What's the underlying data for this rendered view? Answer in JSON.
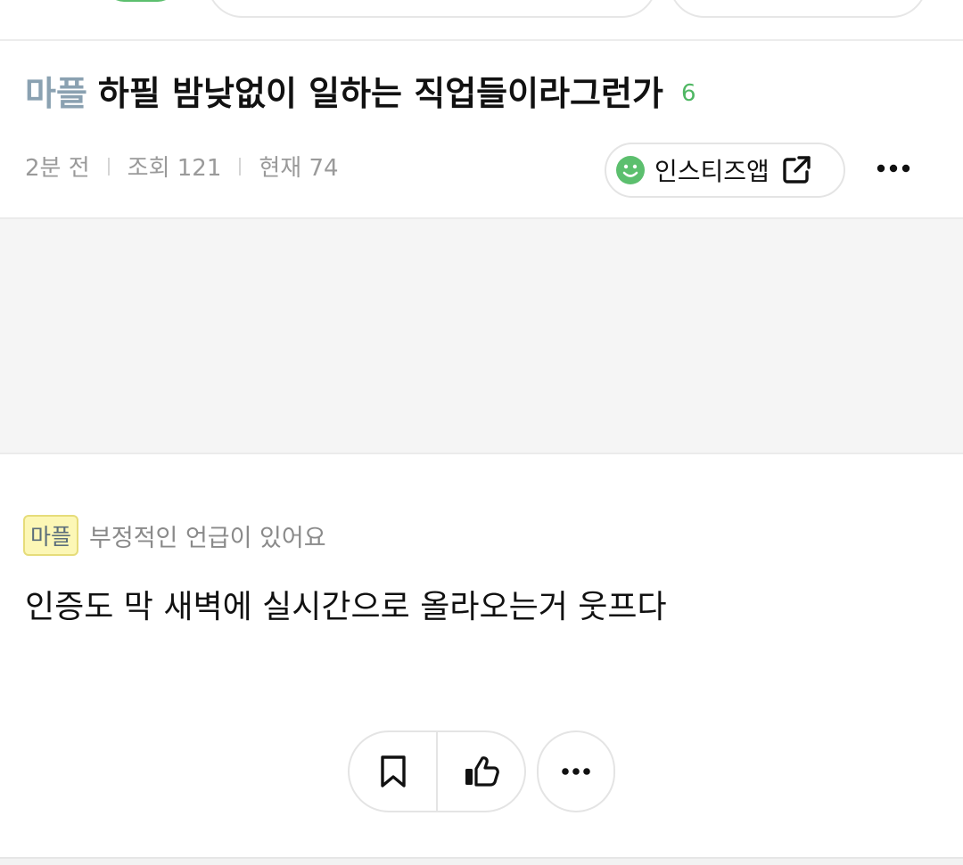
{
  "post": {
    "category": "마플",
    "title": "하필 밤낮없이 일하는 직업들이라그런가",
    "comment_count": "6",
    "time_ago": "2분 전",
    "views": "조회 121",
    "current": "현재 74",
    "app_button_label": "인스티즈앱"
  },
  "comment": {
    "tag": "마플",
    "label": "부정적인 언급이 있어요",
    "body": "인증도 막 새벽에 실시간으로 올라오는거 웃프다"
  },
  "colors": {
    "category": "#8aa1b1",
    "comment_count": "#4fb763",
    "tag_bg": "#fcf7b6"
  },
  "icons": [
    "smile-icon",
    "external-link-icon",
    "more-icon",
    "bookmark-icon",
    "thumbs-up-icon",
    "more-icon"
  ]
}
